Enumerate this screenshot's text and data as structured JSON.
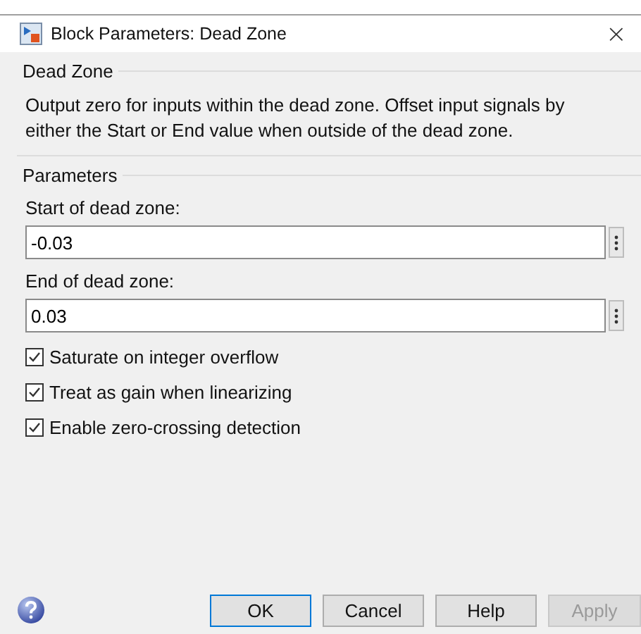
{
  "window": {
    "title": "Block Parameters: Dead Zone",
    "close": "×"
  },
  "block": {
    "title": "Dead Zone",
    "description": "Output zero for inputs within the dead zone.  Offset input signals by either the Start or End value when outside of the dead zone."
  },
  "parameters": {
    "title": "Parameters",
    "fields": [
      {
        "label": "Start of dead zone:",
        "value": "-0.03"
      },
      {
        "label": "End of dead zone:",
        "value": "0.03"
      }
    ],
    "checkboxes": [
      {
        "label": "Saturate on integer overflow",
        "checked": true
      },
      {
        "label": "Treat as gain when linearizing",
        "checked": true
      },
      {
        "label": "Enable zero-crossing detection",
        "checked": true
      }
    ]
  },
  "buttons": [
    {
      "label": "OK",
      "default": true,
      "disabled": false
    },
    {
      "label": "Cancel",
      "default": false,
      "disabled": false
    },
    {
      "label": "Help",
      "default": false,
      "disabled": false
    },
    {
      "label": "Apply",
      "default": false,
      "disabled": true
    }
  ]
}
